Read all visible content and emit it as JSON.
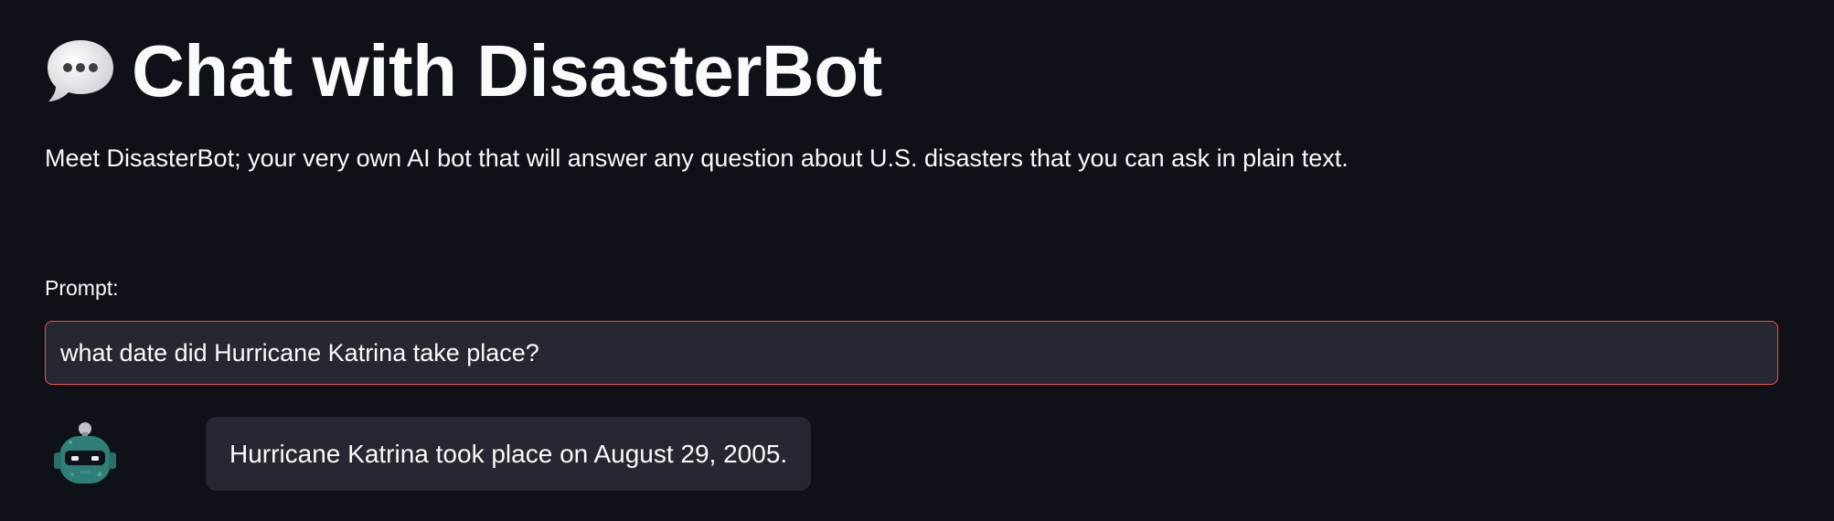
{
  "header": {
    "icon": "speech-bubble-icon",
    "title": "Chat with DisasterBot"
  },
  "description": "Meet DisasterBot; your very own AI bot that will answer any question about U.S. disasters that you can ask in plain text.",
  "prompt": {
    "label": "Prompt:",
    "value": "what date did Hurricane Katrina take place?"
  },
  "chat": {
    "messages": [
      {
        "avatar": "robot-icon",
        "text": "Hurricane Katrina took place on August 29, 2005."
      }
    ]
  },
  "colors": {
    "background": "#0e1117",
    "input_background": "#262730",
    "input_border_focus": "#ff4b4b",
    "text": "#fafafa",
    "bubble_background": "#262730"
  }
}
